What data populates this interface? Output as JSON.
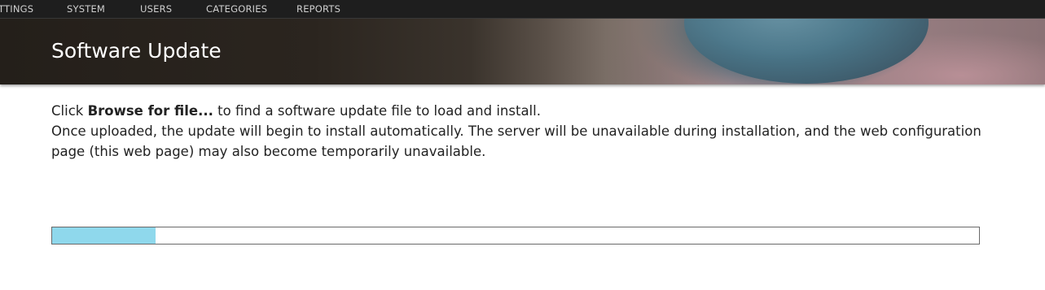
{
  "nav": {
    "items": [
      "TTINGS",
      "SYSTEM",
      "USERS",
      "CATEGORIES",
      "REPORTS"
    ]
  },
  "header": {
    "title": "Software Update"
  },
  "instructions": {
    "line1_prefix": "Click ",
    "line1_bold": "Browse for file...",
    "line1_suffix": " to find a software update file to load and install.",
    "line2": "Once uploaded, the update will begin to install automatically. The server will be unavailable during installation, and the web configuration page (this web page) may also become temporarily unavailable."
  },
  "upload_progress": {
    "fraction": 0.112
  },
  "colors": {
    "nav_bg": "#1e1e1e",
    "progress_fill": "#8fd8ec",
    "progress_border": "#6a6a6a"
  }
}
